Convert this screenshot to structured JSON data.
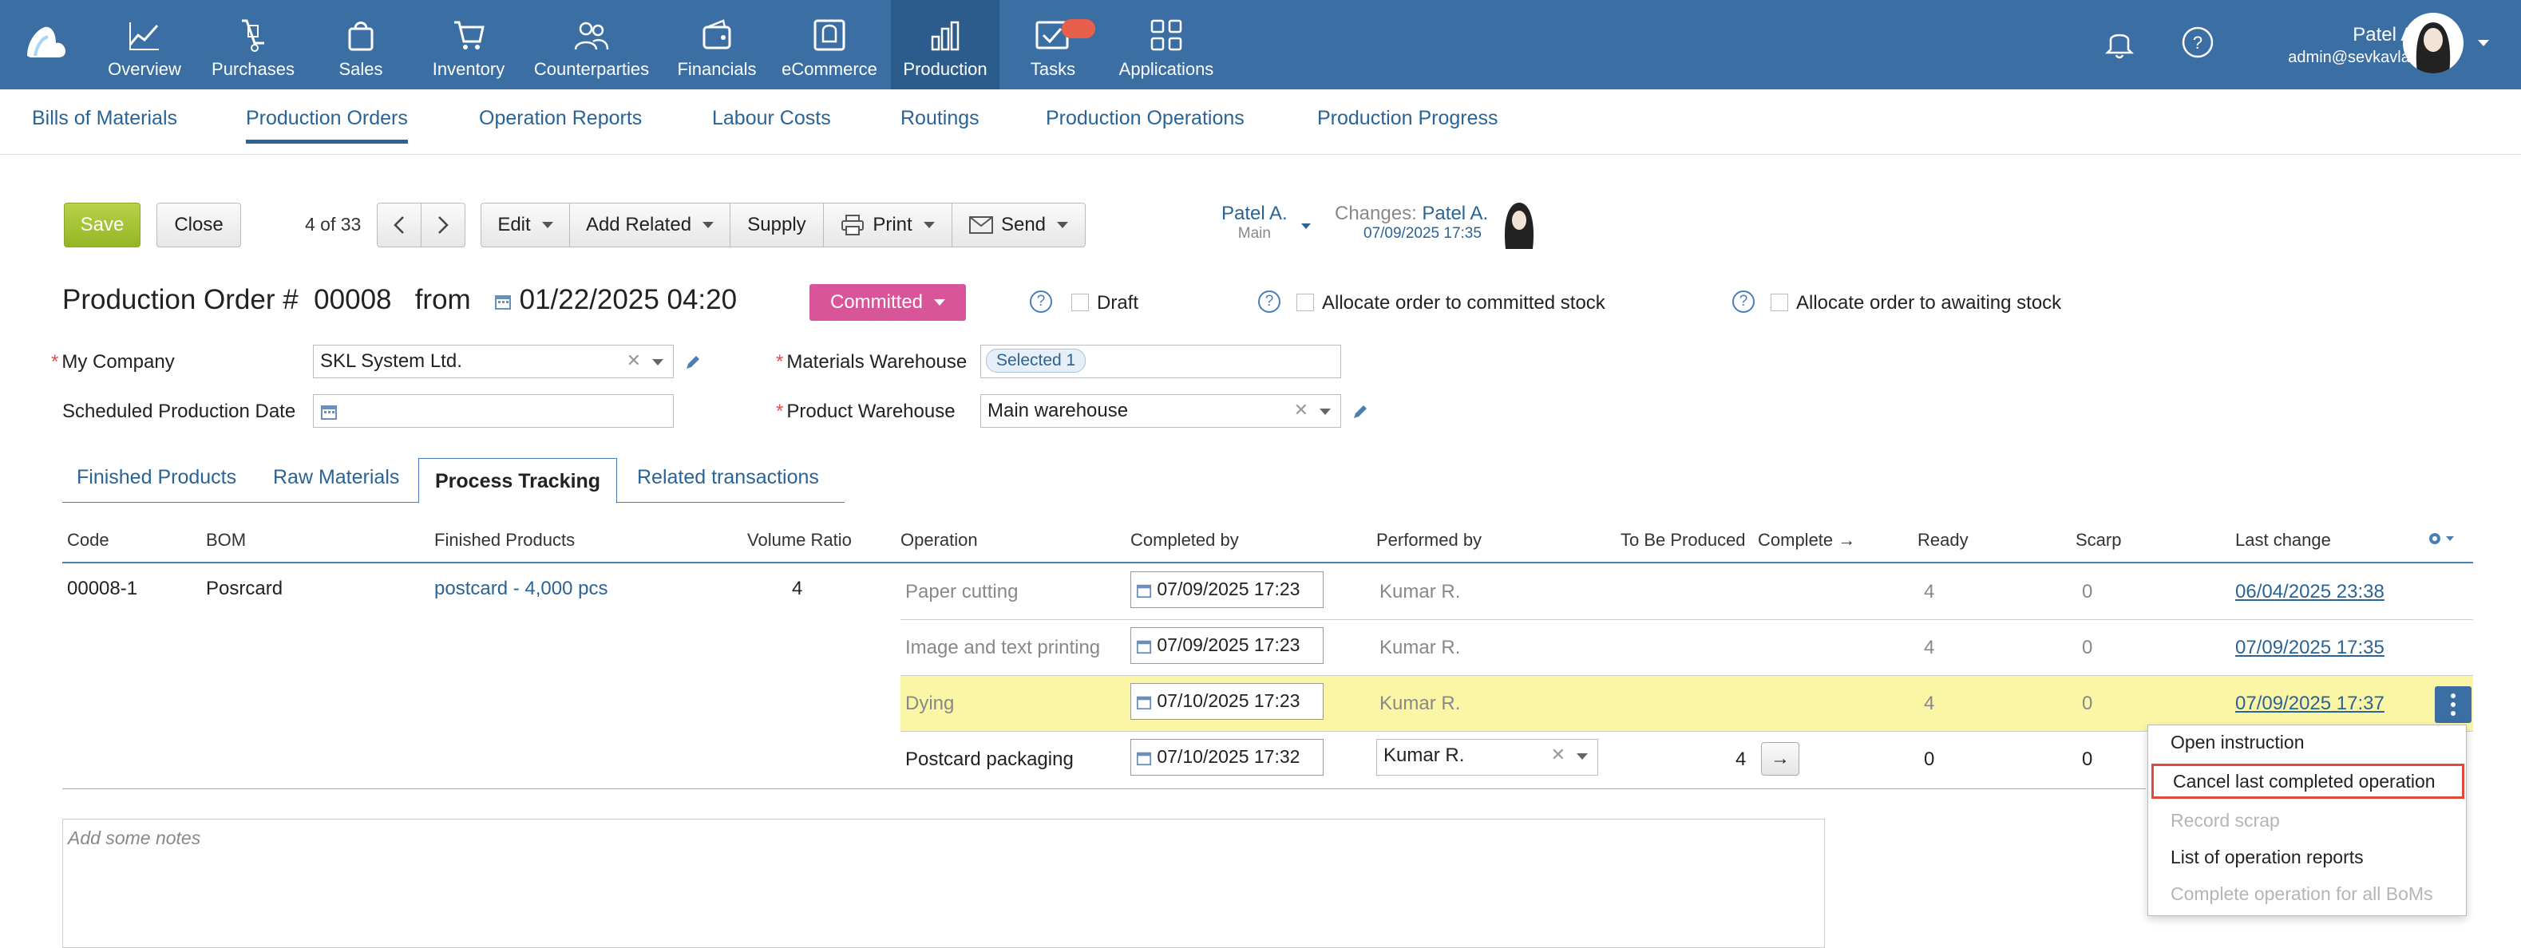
{
  "nav": {
    "items": [
      {
        "label": "Overview",
        "icon": "chart-line-icon"
      },
      {
        "label": "Purchases",
        "icon": "hand-truck-icon"
      },
      {
        "label": "Sales",
        "icon": "shopping-bag-icon"
      },
      {
        "label": "Inventory",
        "icon": "cart-icon"
      },
      {
        "label": "Counterparties",
        "icon": "people-icon"
      },
      {
        "label": "Financials",
        "icon": "wallet-icon"
      },
      {
        "label": "eCommerce",
        "icon": "store-icon"
      },
      {
        "label": "Production",
        "icon": "bar-chart-icon",
        "active": true
      },
      {
        "label": "Tasks",
        "icon": "checkmark-mail-icon"
      },
      {
        "label": "Applications",
        "icon": "apps-grid-icon"
      }
    ],
    "user_name": "Patel A.",
    "user_email": "admin@sevkavlab",
    "accent": "#3b6fa3"
  },
  "subnav": {
    "items": [
      "Bills of Materials",
      "Production Orders",
      "Operation Reports",
      "Labour Costs",
      "Routings",
      "Production Operations",
      "Production Progress"
    ],
    "active": "Production Orders"
  },
  "toolbar": {
    "save": "Save",
    "close": "Close",
    "counter": "4 of 33",
    "edit": "Edit",
    "add_related": "Add Related",
    "supply": "Supply",
    "print": "Print",
    "send": "Send",
    "owner": "Patel A.",
    "owner_sub": "Main",
    "changes_label": "Changes:",
    "changes_who": "Patel A.",
    "changes_when": "07/09/2025 17:35"
  },
  "order": {
    "title_prefix": "Production Order #",
    "number": "00008",
    "from": "from",
    "date": "01/22/2025 04:20",
    "status": "Committed",
    "status_color": "#d9559a",
    "draft_label": "Draft",
    "alloc_committed_label": "Allocate order to committed stock",
    "alloc_awaiting_label": "Allocate order to awaiting stock"
  },
  "form": {
    "my_company_label": "My Company",
    "my_company_value": "SKL System Ltd.",
    "scheduled_label": "Scheduled Production Date",
    "scheduled_value": "",
    "materials_wh_label": "Materials Warehouse",
    "materials_wh_tag": "Selected 1",
    "product_wh_label": "Product Warehouse",
    "product_wh_value": "Main warehouse"
  },
  "tabs": [
    "Finished Products",
    "Raw Materials",
    "Process Tracking",
    "Related transactions"
  ],
  "table": {
    "headers": [
      "Code",
      "BOM",
      "Finished Products",
      "Volume Ratio",
      "Operation",
      "Completed by",
      "Performed by",
      "To Be Produced",
      "Complete →",
      "Ready",
      "Scarp",
      "Last change"
    ],
    "code": "00008-1",
    "bom": "Posrcard",
    "finished_products": "postcard - 4,000 pcs",
    "volume_ratio": "4",
    "rows": [
      {
        "operation": "Paper cutting",
        "completed_by": "07/09/2025 17:23",
        "performed_by": "Kumar R.",
        "to_be_produced": "",
        "ready": "4",
        "scarp": "0",
        "last_change": "06/04/2025 23:38"
      },
      {
        "operation": "Image and text printing",
        "completed_by": "07/09/2025 17:23",
        "performed_by": "Kumar R.",
        "to_be_produced": "",
        "ready": "4",
        "scarp": "0",
        "last_change": "07/09/2025 17:35"
      },
      {
        "operation": "Dying",
        "completed_by": "07/10/2025 17:23",
        "performed_by": "Kumar R.",
        "to_be_produced": "",
        "ready": "4",
        "scarp": "0",
        "last_change": "07/09/2025 17:37"
      },
      {
        "operation": "Postcard packaging",
        "completed_by": "07/10/2025 17:32",
        "performed_by": "Kumar R.",
        "to_be_produced": "4",
        "ready": "0",
        "scarp": "0",
        "last_change": ""
      }
    ],
    "highlight_color": "#fbf6a6"
  },
  "context_menu": {
    "items": [
      {
        "label": "Open instruction",
        "disabled": false
      },
      {
        "label": "Cancel last completed operation",
        "disabled": false,
        "highlighted": true
      },
      {
        "label": "Record scrap",
        "disabled": true
      },
      {
        "label": "List of operation reports",
        "disabled": false
      },
      {
        "label": "Complete operation for all BoMs",
        "disabled": true
      }
    ]
  },
  "notes": {
    "placeholder": "Add some notes"
  }
}
